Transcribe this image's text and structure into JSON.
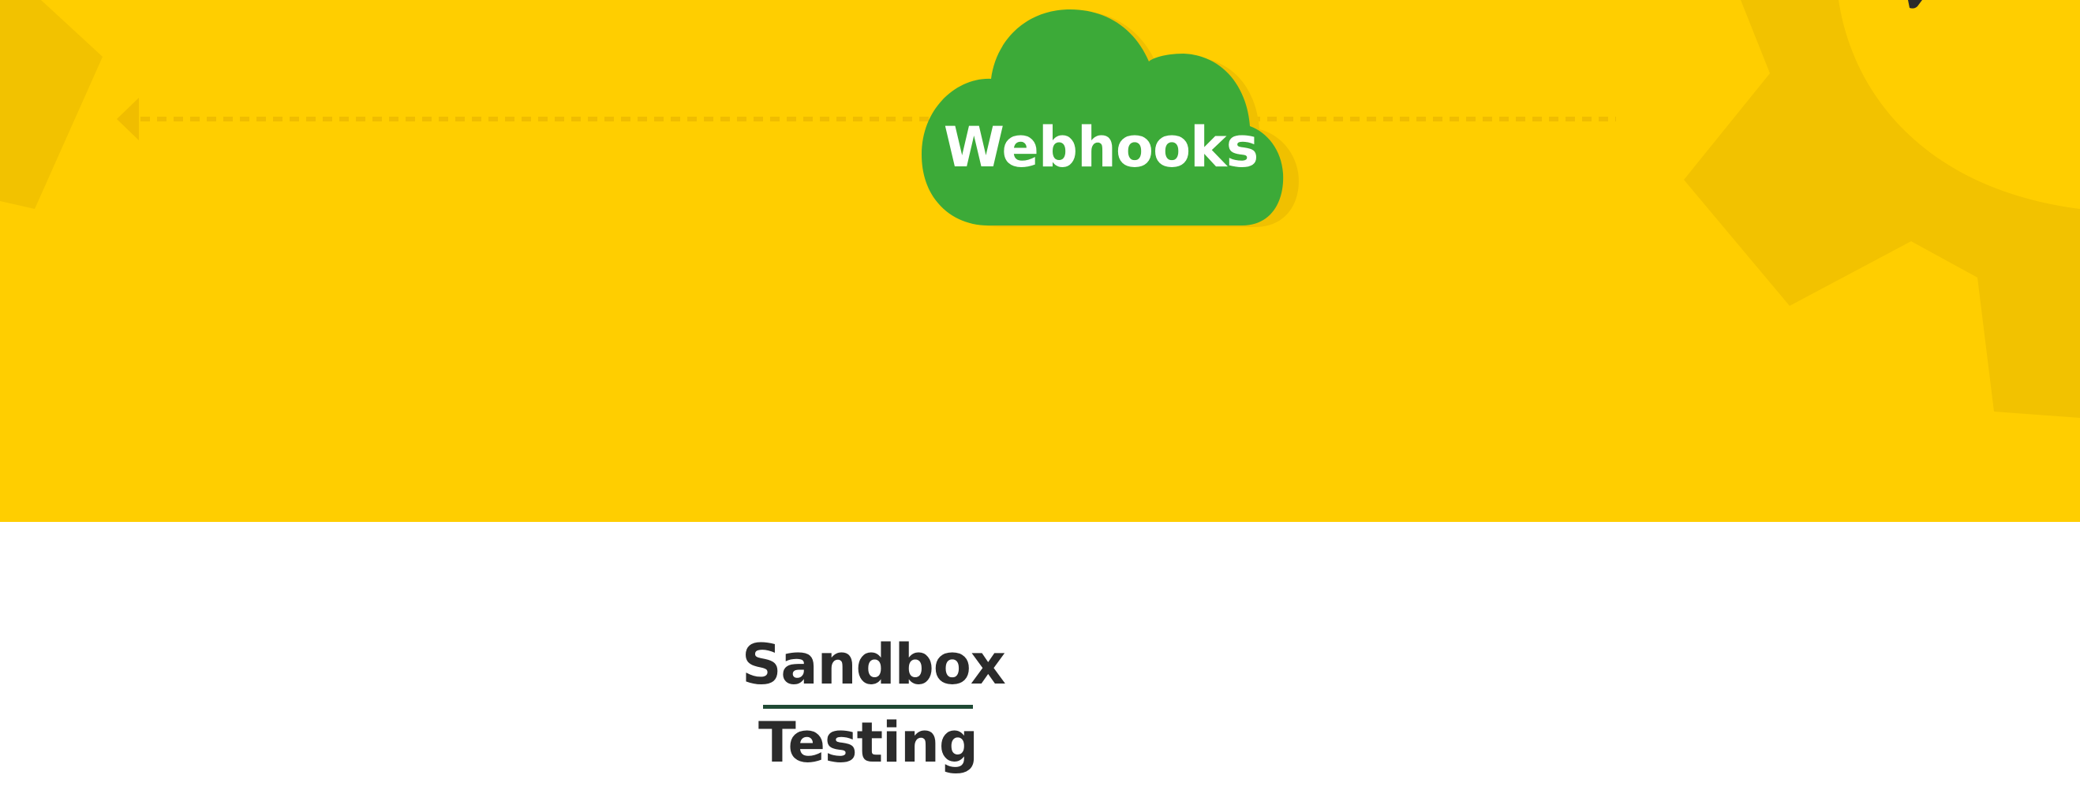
{
  "hero": {
    "cloud_label": "Webhooks"
  },
  "sandbox": {
    "line1": "Sandbox",
    "line2": "Testing"
  },
  "colors": {
    "hero_background": "#ffce00",
    "hero_shapes": "#f2c200",
    "cloud_green": "#3caa38",
    "heading_text": "#2b2b2b",
    "underline": "#1f4a34"
  },
  "icons": {
    "hero_left": "arrow-left-icon",
    "hero_center": "cloud-icon",
    "hero_right": "gear-icon"
  }
}
